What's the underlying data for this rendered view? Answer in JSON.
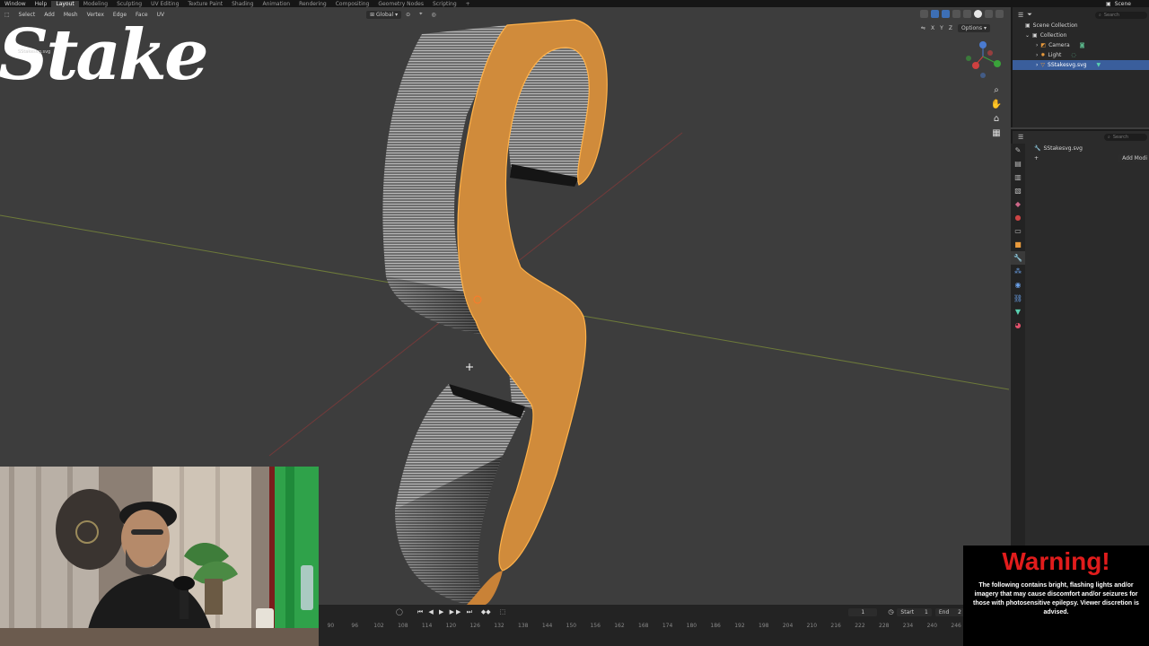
{
  "topbar": {
    "menus": [
      "Window",
      "Help"
    ],
    "workspace_tabs": [
      "Layout",
      "Modeling",
      "Sculpting",
      "UV Editing",
      "Texture Paint",
      "Shading",
      "Animation",
      "Rendering",
      "Compositing",
      "Geometry Nodes",
      "Scripting"
    ],
    "active_tab": "Layout",
    "scene_label": "Scene"
  },
  "viewport_header": {
    "menus": [
      "Select",
      "Add",
      "Mesh",
      "Vertex",
      "Edge",
      "Face",
      "UV"
    ],
    "transform_orientation": "Global",
    "options_label": "Options",
    "mirror_axes": [
      "X",
      "Y",
      "Z"
    ]
  },
  "outliner": {
    "search_placeholder": "Search",
    "root": "Scene Collection",
    "collection": "Collection",
    "items": [
      "Camera",
      "Light",
      "SStakesvg.svg"
    ],
    "selected_item": "SStakesvg.svg"
  },
  "properties": {
    "search_placeholder": "Search",
    "object_name": "SStakesvg.svg",
    "add_modifier_label": "Add Modi"
  },
  "timeline": {
    "current_frame": "1",
    "start_label": "Start",
    "start_value": "1",
    "end_label": "End",
    "end_value": "2",
    "ruler_ticks": [
      "90",
      "96",
      "102",
      "108",
      "114",
      "120",
      "126",
      "132",
      "138",
      "144",
      "150",
      "156",
      "162",
      "168",
      "174",
      "180",
      "186",
      "192",
      "198",
      "204",
      "210",
      "216",
      "222",
      "228",
      "234",
      "240",
      "246"
    ]
  },
  "overlay": {
    "logo_text": "Stake",
    "logo_subtext": "SStakesvg.svg",
    "warning_title": "Warning!",
    "warning_body": "The following contains bright, flashing lights and/or imagery that may cause discomfort and/or seizures for those with photosensitive epilepsy. Viewer discretion is advised."
  },
  "colors": {
    "viewport_bg": "#3d3d3d",
    "selection_orange": "#d08b3b",
    "selection_blue": "#3a5e9c",
    "warning_red": "#e11c1c"
  }
}
